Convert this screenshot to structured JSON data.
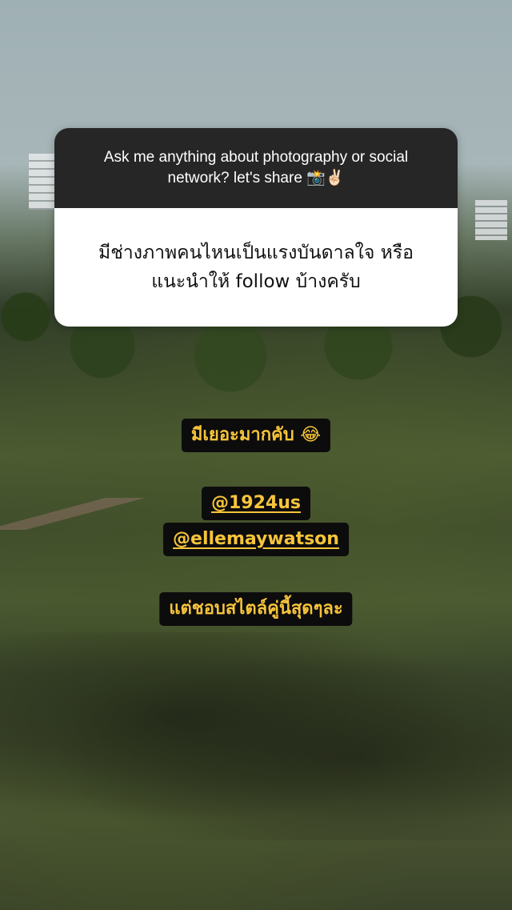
{
  "question_sticker": {
    "prompt": "Ask me anything about photography or social network? let's share 📸✌🏻",
    "question": "มีช่างภาพคนไหนเป็นแรงบันดาลใจ หรือแนะนำให้ follow บ้างครับ"
  },
  "answer": {
    "line1": "มีเยอะมากคับ 😂",
    "mention1": "@1924us",
    "mention2": "@ellemaywatson",
    "line4": "แต่ชอบสไตล์คู่นี้สุดๆละ"
  },
  "colors": {
    "label_background": "#0c0c0c",
    "label_text": "#f7c43a",
    "card_header": "#262626",
    "card_body": "#ffffff"
  }
}
